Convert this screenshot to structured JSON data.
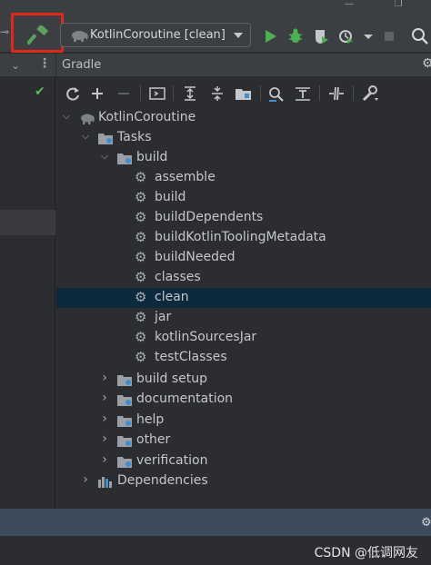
{
  "toolbar": {
    "run_config": "KotlinCoroutine [clean]"
  },
  "gradle_panel": {
    "title": "Gradle"
  },
  "tree": {
    "project": "KotlinCoroutine",
    "tasks": "Tasks",
    "build_group": "build",
    "build_tasks": [
      "assemble",
      "build",
      "buildDependents",
      "buildKotlinToolingMetadata",
      "buildNeeded",
      "classes",
      "clean",
      "jar",
      "kotlinSourcesJar",
      "testClasses"
    ],
    "other_groups": [
      "build setup",
      "documentation",
      "help",
      "other",
      "verification"
    ],
    "dependencies": "Dependencies"
  },
  "selected_task": "clean",
  "watermark": "CSDN @低调网友",
  "colors": {
    "highlight_box": "#e1261c",
    "run_green": "#4caf50",
    "selection": "#0d293e",
    "bottom_bar": "#3d4b5c"
  }
}
